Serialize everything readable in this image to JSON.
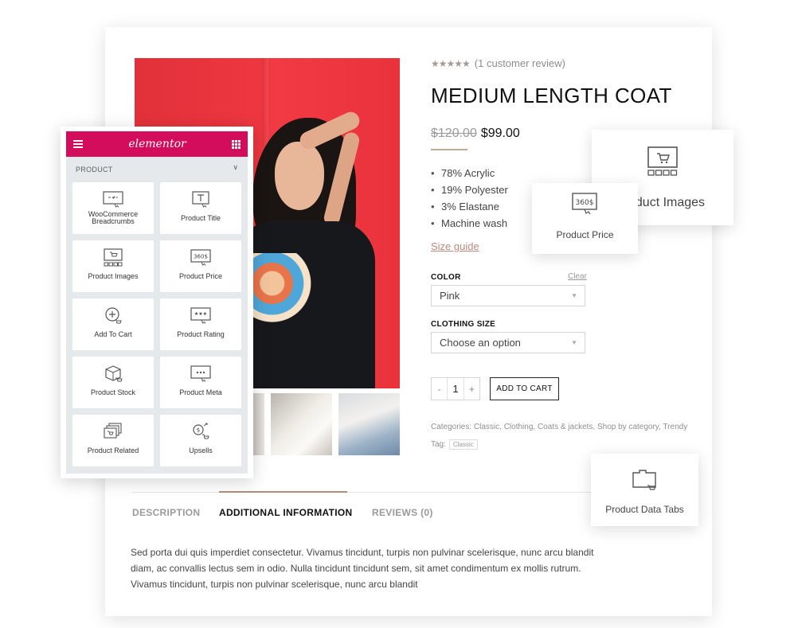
{
  "product": {
    "rating_stars": "★★★★★",
    "review_count_text": "(1 customer review)",
    "title": "MEDIUM LENGTH COAT",
    "old_price": "$120.00",
    "new_price": "$99.00",
    "features": [
      "78% Acrylic",
      "19% Polyester",
      "3% Elastane",
      "Machine wash"
    ],
    "size_guide_link": "Size guide",
    "color_label": "COLOR",
    "clear_link": "Clear",
    "color_value": "Pink",
    "size_label": "CLOTHING SIZE",
    "size_value": "Choose an option",
    "quantity": "1",
    "qty_minus": "-",
    "qty_plus": "+",
    "add_to_cart_label": "ADD TO CART",
    "categories_text": "Categories: Classic, Clothing, Coats & jackets, Shop by category, Trendy",
    "tag_label": "Tag:",
    "tag_value": "Classic"
  },
  "tabs": [
    {
      "label": "DESCRIPTION",
      "active": false
    },
    {
      "label": "ADDITIONAL INFORMATION",
      "active": true
    },
    {
      "label": "REVIEWS (0)",
      "active": false
    }
  ],
  "description_text": "Sed porta dui quis imperdiet consectetur. Vivamus tincidunt, turpis non pulvinar scelerisque, nunc arcu blandit diam, ac convallis lectus sem in odio. Nulla tincidunt tincidunt sem, sit amet condimentum ex mollis rutrum. Vivamus tincidunt, turpis non pulvinar scelerisque, nunc arcu blandit",
  "floating_cards": {
    "product_images_label": "Product Images",
    "product_price_label": "Product Price",
    "product_data_tabs_label": "Product Data Tabs"
  },
  "elementor_panel": {
    "brand": "elementor",
    "section_title": "PRODUCT",
    "widgets": [
      {
        "label": "WooCommerce Breadcrumbs",
        "icon": "breadcrumbs-icon"
      },
      {
        "label": "Product Title",
        "icon": "product-title-icon"
      },
      {
        "label": "Product Images",
        "icon": "product-images-icon"
      },
      {
        "label": "Product Price",
        "icon": "product-price-icon"
      },
      {
        "label": "Add To Cart",
        "icon": "add-to-cart-icon"
      },
      {
        "label": "Product Rating",
        "icon": "product-rating-icon"
      },
      {
        "label": "Product Stock",
        "icon": "product-stock-icon"
      },
      {
        "label": "Product Meta",
        "icon": "product-meta-icon"
      },
      {
        "label": "Product Related",
        "icon": "product-related-icon"
      },
      {
        "label": "Upsells",
        "icon": "upsells-icon"
      }
    ]
  },
  "colors": {
    "elementor_brand": "#d30c5c",
    "accent": "#b68b7e",
    "hero_red": "#ee3640"
  }
}
